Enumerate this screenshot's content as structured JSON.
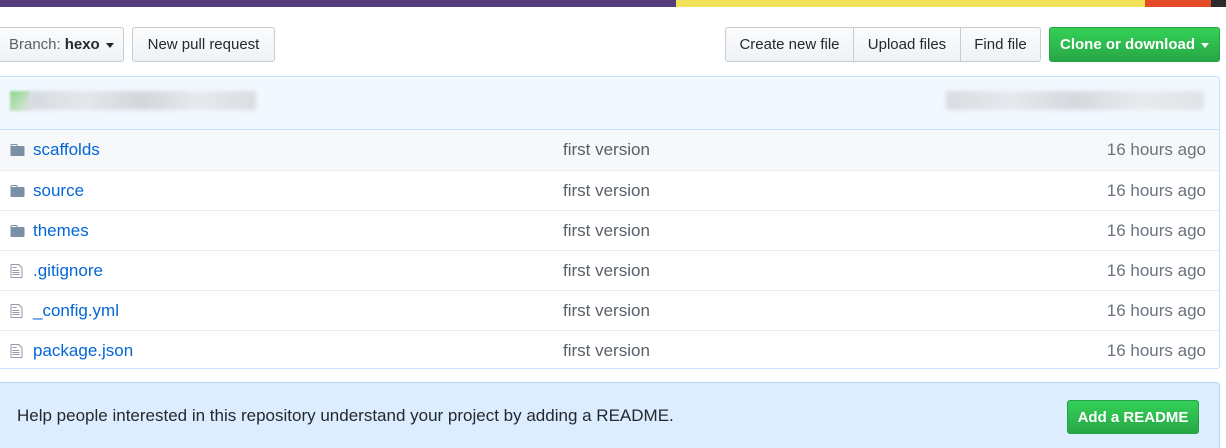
{
  "colors": {
    "lang_bar": [
      "#563d7c",
      "#f1e05a",
      "#e34c26",
      "#2b2b2b"
    ],
    "link": "#0366d6",
    "accent_green": "#28a745",
    "commit_bar_bg": "#f1f8ff",
    "readme_bg": "#dbedff"
  },
  "toolbar": {
    "branch_prefix": "Branch:",
    "branch_value": "hexo",
    "new_pull_request": "New pull request",
    "create_new_file": "Create new file",
    "upload_files": "Upload files",
    "find_file": "Find file",
    "clone_or_download": "Clone or download"
  },
  "files": [
    {
      "name": "scaffolds",
      "type": "folder",
      "icon": "folder-icon",
      "message": "first version",
      "age": "16 hours ago"
    },
    {
      "name": "source",
      "type": "folder",
      "icon": "folder-icon",
      "message": "first version",
      "age": "16 hours ago"
    },
    {
      "name": "themes",
      "type": "folder",
      "icon": "folder-icon",
      "message": "first version",
      "age": "16 hours ago"
    },
    {
      "name": ".gitignore",
      "type": "file",
      "icon": "file-icon",
      "message": "first version",
      "age": "16 hours ago"
    },
    {
      "name": "_config.yml",
      "type": "file",
      "icon": "file-icon",
      "message": "first version",
      "age": "16 hours ago"
    },
    {
      "name": "package.json",
      "type": "file",
      "icon": "file-icon",
      "message": "first version",
      "age": "16 hours ago"
    }
  ],
  "readme": {
    "text": "Help people interested in this repository understand your project by adding a README.",
    "button": "Add a README"
  }
}
